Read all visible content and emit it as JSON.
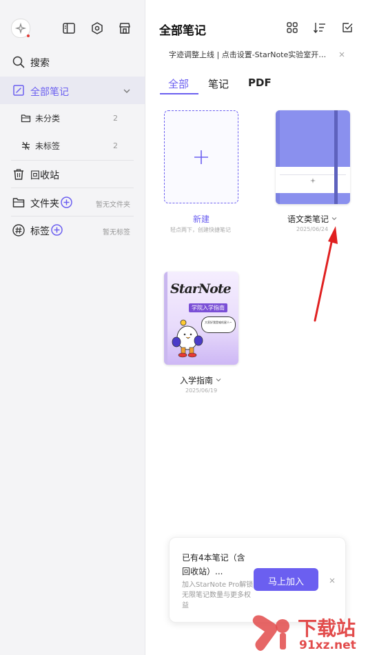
{
  "sidebar": {
    "search_label": "搜索",
    "all_notes_label": "全部笔记",
    "uncategorized_label": "未分类",
    "uncategorized_count": "2",
    "untagged_label": "未标签",
    "untagged_count": "2",
    "trash_label": "回收站",
    "folders_label": "文件夹",
    "folders_empty": "暂无文件夹",
    "tags_label": "标签",
    "tags_empty": "暂无标签"
  },
  "header": {
    "title": "全部笔记"
  },
  "banner": {
    "text": "字迹调整上线 | 点击设置-StarNote实验室开…"
  },
  "tabs": [
    {
      "label": "全部",
      "active": true
    },
    {
      "label": "笔记",
      "active": false
    },
    {
      "label": "PDF",
      "active": false
    }
  ],
  "notes": {
    "new": {
      "label": "新建",
      "hint": "轻点两下，创建快捷笔记"
    },
    "items": [
      {
        "name": "语文类笔记",
        "date": "2025/06/24"
      },
      {
        "name": "入学指南",
        "date": "2025/06/19"
      }
    ],
    "cover_title": "StarNote",
    "cover_subtitle": "学院入学指南",
    "cover_bubble": "大家好我是喵叽星人~"
  },
  "promo": {
    "title": "已有4本笔记（含回收站）...",
    "desc": "加入StarNote Pro解锁无限笔记数量与更多权益",
    "button": "马上加入"
  },
  "watermark": {
    "text_top": "下载站",
    "text_bottom": "91xz.net"
  },
  "colors": {
    "accent": "#6b5ff0",
    "sidebar_bg": "#f4f4f6",
    "active_row_bg": "#e9e9f2",
    "notebook_cover": "#8a90ee",
    "annotation_arrow": "#e02020"
  }
}
